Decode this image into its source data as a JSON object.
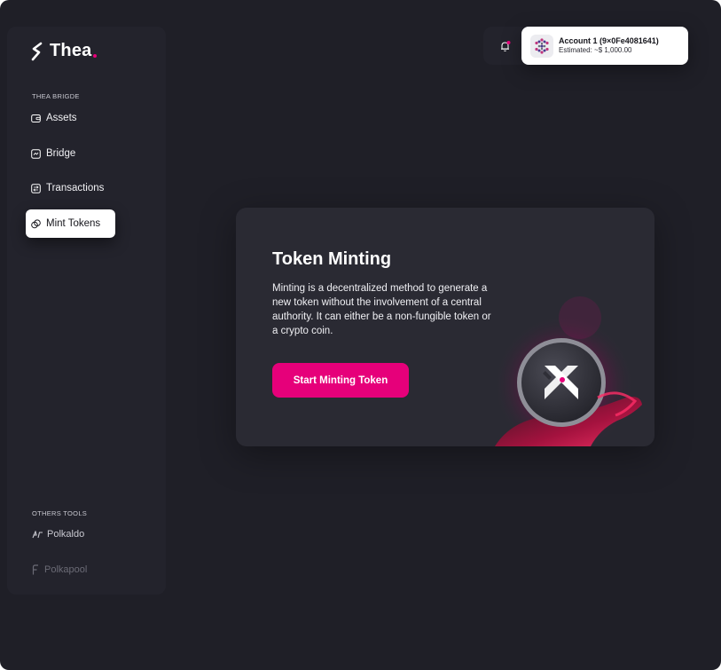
{
  "brand": {
    "name": "Thea",
    "accent": "#e6007a"
  },
  "sidebar": {
    "section_bridge": "THEA BRIGDE",
    "items": [
      {
        "label": "Assets",
        "icon": "wallet-icon"
      },
      {
        "label": "Bridge",
        "icon": "bridge-icon"
      },
      {
        "label": "Transactions",
        "icon": "transactions-icon"
      },
      {
        "label": "Mint Tokens",
        "icon": "mint-icon",
        "active": true
      }
    ],
    "section_tools": "OTHERS TOOLS",
    "tools": [
      {
        "label": "Polkaldo",
        "icon": "polkaldo-icon"
      },
      {
        "label": "Polkapool",
        "icon": "polkapool-icon"
      }
    ]
  },
  "header": {
    "notification_icon": "bell-icon",
    "account": {
      "name": "Account 1 (9×0Fe4081641)",
      "estimated": "Estimated: ~$ 1,000.00"
    }
  },
  "card": {
    "title": "Token Minting",
    "description": "Minting is a decentralized method to generate a new token without the involvement of a central authority. It can either be a non-fungible token or a crypto coin.",
    "cta_label": "Start Minting Token"
  }
}
